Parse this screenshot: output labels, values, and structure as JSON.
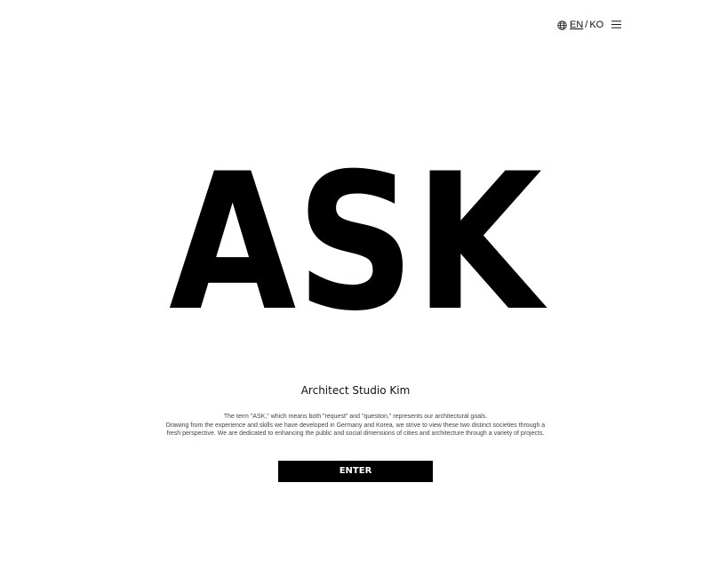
{
  "header": {
    "language": {
      "icon": "globe-icon",
      "active": "EN",
      "separator": "/",
      "alternate": "KO"
    },
    "menu_icon": "hamburger-menu-icon"
  },
  "hero": {
    "title": "ASK"
  },
  "studio_name": "Architect Studio Kim",
  "description": {
    "line1": "The term \"ASK,\" which means both \"request\" and \"question,\" represents our architectural goals.",
    "line2": "Drawing from the experience and skills we have developed in Germany and Korea, we strive to view these two distinct societies through a",
    "line3": "fresh perspective. We are dedicated to enhancing the public and social dimensions of cities and architecture through a variety of projects."
  },
  "enter_button": {
    "label": "ENTER"
  },
  "colors": {
    "background": "#ffffff",
    "text": "#000000",
    "button_bg": "#000000",
    "button_text": "#ffffff",
    "body_text": "#444444"
  }
}
